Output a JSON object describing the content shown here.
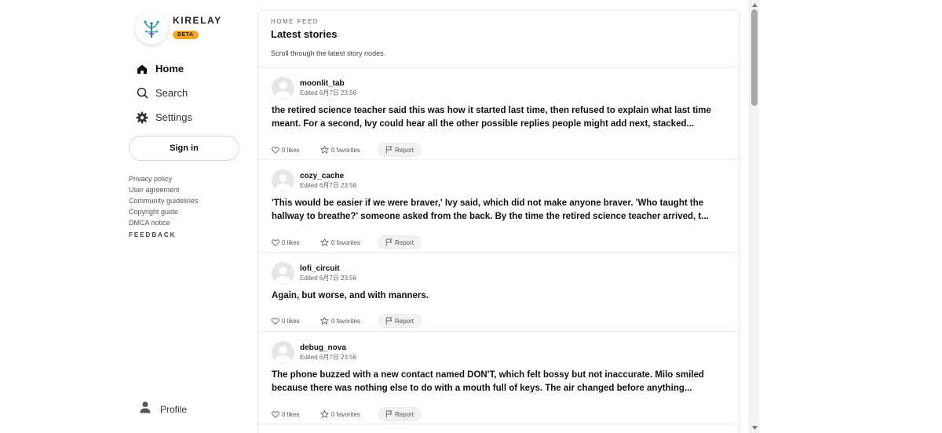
{
  "brand": {
    "name": "KIRELAY",
    "badge": "BETA"
  },
  "nav": [
    {
      "label": "Home",
      "icon": "home-icon",
      "active": true
    },
    {
      "label": "Search",
      "icon": "search-icon",
      "active": false
    },
    {
      "label": "Settings",
      "icon": "gear-icon",
      "active": false
    }
  ],
  "signin_label": "Sign in",
  "footer_links": [
    "Privacy policy",
    "User agreement",
    "Community guidelines",
    "Copyright guide",
    "DMCA notice"
  ],
  "feedback_label": "FEEDBACK",
  "profile_label": "Profile",
  "feed": {
    "overline": "HOME FEED",
    "title": "Latest stories",
    "subtitle": "Scroll through the latest story nodes."
  },
  "posts": [
    {
      "username": "moonlit_tab",
      "edited": "Edited 6月7日 23:56",
      "body": "the retired science teacher said this was how it started last time, then refused to explain what last time meant. For a second, Ivy could hear all the other possible replies people might add next, stacked...",
      "likes": "0 likes",
      "favorites": "0 favorites",
      "report": "Report"
    },
    {
      "username": "cozy_cache",
      "edited": "Edited 6月7日 23:56",
      "body": "'This would be easier if we were braver,' Ivy said, which did not make anyone braver. 'Who taught the hallway to breathe?' someone asked from the back. By the time the retired science teacher arrived, t...",
      "likes": "0 likes",
      "favorites": "0 favorites",
      "report": "Report"
    },
    {
      "username": "lofi_circuit",
      "edited": "Edited 6月7日 23:56",
      "body": "Again, but worse, and with manners.",
      "likes": "0 likes",
      "favorites": "0 favorites",
      "report": "Report"
    },
    {
      "username": "debug_nova",
      "edited": "Edited 6月7日 23:56",
      "body": "The phone buzzed with a new contact named DON'T, which felt bossy but not inaccurate. Milo smiled because there was nothing else to do with a mouth full of keys. The air changed before anything...",
      "likes": "0 likes",
      "favorites": "0 favorites",
      "report": "Report"
    }
  ],
  "colors": {
    "beta_badge": "#f5a623",
    "logo_teal": "#2a9d8f"
  }
}
